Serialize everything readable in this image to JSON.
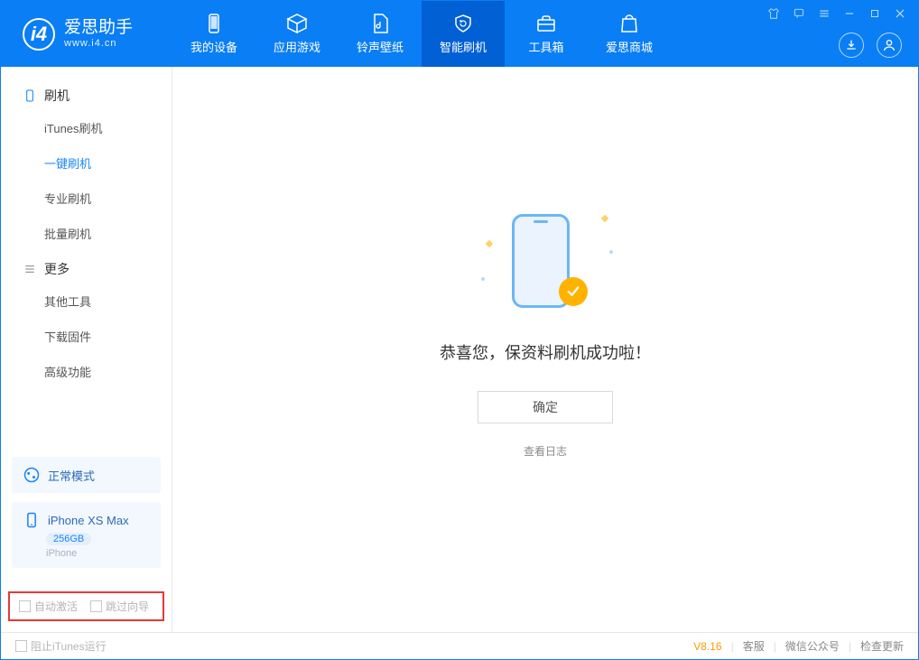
{
  "app": {
    "title": "爱思助手",
    "subtitle": "www.i4.cn"
  },
  "tabs": [
    {
      "label": "我的设备"
    },
    {
      "label": "应用游戏"
    },
    {
      "label": "铃声壁纸"
    },
    {
      "label": "智能刷机"
    },
    {
      "label": "工具箱"
    },
    {
      "label": "爱思商城"
    }
  ],
  "sidebar": {
    "group1": {
      "title": "刷机",
      "items": [
        "iTunes刷机",
        "一键刷机",
        "专业刷机",
        "批量刷机"
      ]
    },
    "group2": {
      "title": "更多",
      "items": [
        "其他工具",
        "下载固件",
        "高级功能"
      ]
    }
  },
  "device_mode": {
    "label": "正常模式"
  },
  "device": {
    "name": "iPhone XS Max",
    "capacity": "256GB",
    "type": "iPhone"
  },
  "options": {
    "auto_activate": "自动激活",
    "skip_guide": "跳过向导"
  },
  "main": {
    "success": "恭喜您，保资料刷机成功啦！",
    "ok": "确定",
    "view_log": "查看日志"
  },
  "footer": {
    "block_itunes": "阻止iTunes运行",
    "version": "V8.16",
    "links": [
      "客服",
      "微信公众号",
      "检查更新"
    ]
  }
}
